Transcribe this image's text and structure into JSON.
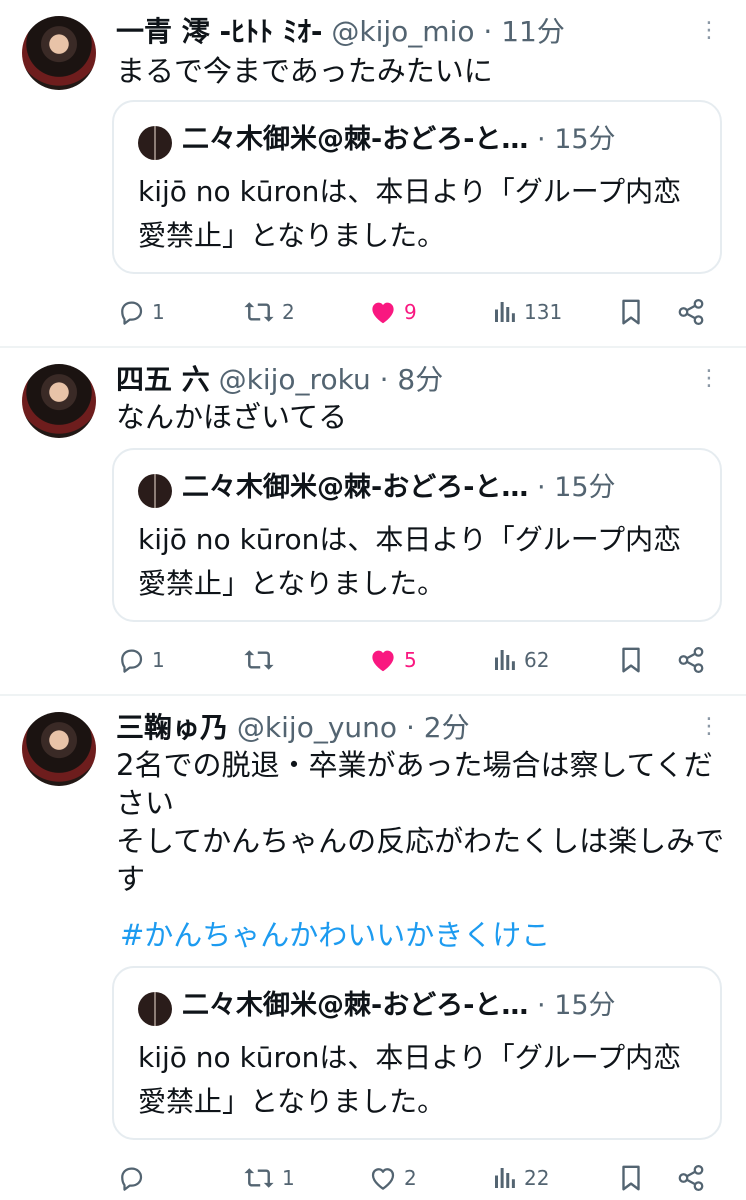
{
  "tweets": [
    {
      "author_name": "一青 澪 -ﾋﾄﾄ ﾐｵ-",
      "handle": "@kijo_mio",
      "time": "11分",
      "text": "まるで今まであったみたいに",
      "hashtag": "",
      "quote": {
        "author_name": "二々木御米@棘-おどろ-と…",
        "time": "15分",
        "text": "kijō no kūronは、本日より「グループ内恋愛禁止」となりました。"
      },
      "replies": "1",
      "retweets": "2",
      "likes": "9",
      "liked": true,
      "views": "131"
    },
    {
      "author_name": "四五 六",
      "handle": "@kijo_roku",
      "time": "8分",
      "text": "なんかほざいてる",
      "hashtag": "",
      "quote": {
        "author_name": "二々木御米@棘-おどろ-と…",
        "time": "15分",
        "text": "kijō no kūronは、本日より「グループ内恋愛禁止」となりました。"
      },
      "replies": "1",
      "retweets": "",
      "likes": "5",
      "liked": true,
      "views": "62"
    },
    {
      "author_name": "三鞠ゅ乃",
      "handle": "@kijo_yuno",
      "time": "2分",
      "text": "2名での脱退・卒業があった場合は察してください\nそしてかんちゃんの反応がわたくしは楽しみです",
      "hashtag": "#かんちゃんかわいいかきくけこ",
      "quote": {
        "author_name": "二々木御米@棘-おどろ-と…",
        "time": "15分",
        "text": "kijō no kūronは、本日より「グループ内恋愛禁止」となりました。"
      },
      "replies": "",
      "retweets": "1",
      "likes": "2",
      "liked": false,
      "views": "22"
    }
  ],
  "separator": "·",
  "colors": {
    "text": "#0f1419",
    "secondary": "#536471",
    "like_active": "#f91880",
    "link": "#1d9bf0",
    "border": "#e6ecf0"
  },
  "icons": [
    "reply-icon",
    "retweet-icon",
    "heart-icon",
    "views-icon",
    "bookmark-icon",
    "share-icon",
    "more-icon"
  ]
}
